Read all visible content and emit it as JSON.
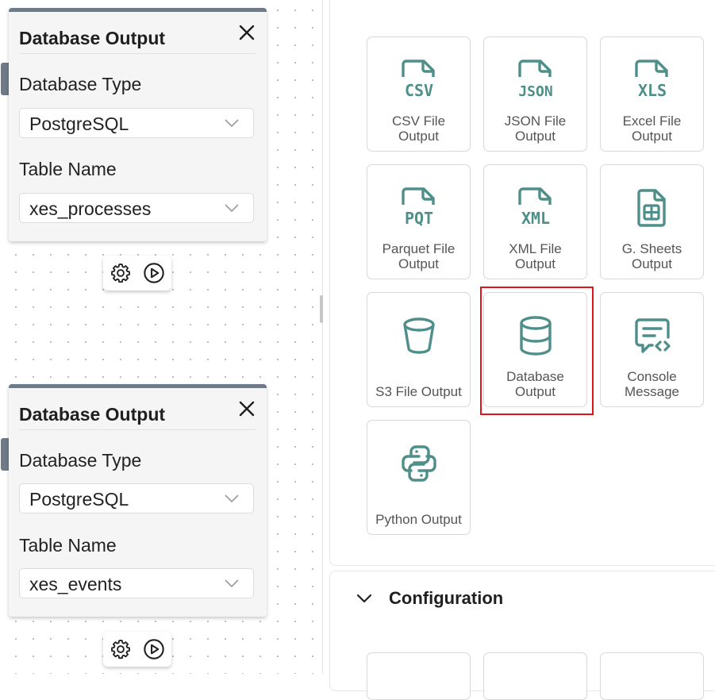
{
  "nodes": [
    {
      "title": "Database Output",
      "fields": [
        {
          "label": "Database Type",
          "value": "PostgreSQL"
        },
        {
          "label": "Table Name",
          "value": "xes_processes"
        }
      ]
    },
    {
      "title": "Database Output",
      "fields": [
        {
          "label": "Database Type",
          "value": "PostgreSQL"
        },
        {
          "label": "Table Name",
          "value": "xes_events"
        }
      ]
    }
  ],
  "palette": {
    "tiles": [
      {
        "label": "CSV File Output",
        "icon": "csv-file-icon",
        "glyph": "CSV"
      },
      {
        "label": "JSON File Output",
        "icon": "json-file-icon",
        "glyph": "JSON"
      },
      {
        "label": "Excel File Output",
        "icon": "xls-file-icon",
        "glyph": "XLS"
      },
      {
        "label": "Parquet File Output",
        "icon": "pqt-file-icon",
        "glyph": "PQT"
      },
      {
        "label": "XML File Output",
        "icon": "xml-file-icon",
        "glyph": "XML"
      },
      {
        "label": "G. Sheets Output",
        "icon": "spreadsheet-icon"
      },
      {
        "label": "S3 File Output",
        "icon": "bucket-icon"
      },
      {
        "label": "Database Output",
        "icon": "database-icon",
        "highlighted": true
      },
      {
        "label": "Console Message",
        "icon": "console-message-icon"
      },
      {
        "label": "Python Output",
        "icon": "python-icon"
      }
    ]
  },
  "configuration": {
    "title": "Configuration"
  },
  "colors": {
    "icon_teal": "#4f8f8a",
    "node_accent": "#6f7a87",
    "highlight": "#e0141b"
  }
}
